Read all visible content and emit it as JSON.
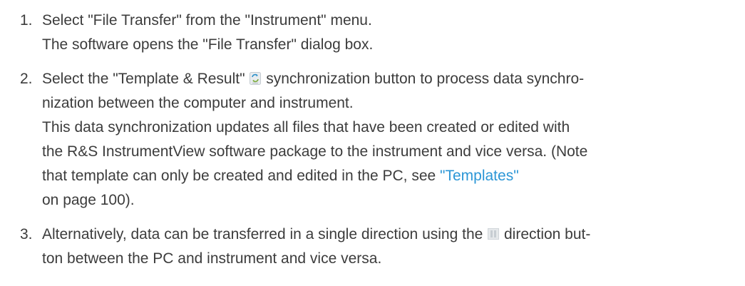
{
  "steps": [
    {
      "number": "1.",
      "lines": [
        "Select \"File Transfer\" from the \"Instrument\" menu.",
        "The software opens the \"File Transfer\" dialog box."
      ]
    },
    {
      "number": "2.",
      "line1_before_icon": "Select the \"Template & Result\" ",
      "sync_icon": "sync-icon",
      "line1_after_icon": " synchronization button to process data synchro-",
      "line2": "nization between the computer and instrument.",
      "line3": "This data synchronization updates all files that have been created or edited with",
      "line4": "the R&S InstrumentView software package to the instrument and vice versa. (Note",
      "line5_before_link": "that template can only be created and edited in the PC, see ",
      "link_text": "\"Templates\"",
      "line6": "on page 100)."
    },
    {
      "number": "3.",
      "line1_before_icon": "Alternatively, data can be transferred in a single direction using the ",
      "direction_icon": "direction-icon",
      "line1_after_icon": " direction but-",
      "line2": "ton between the PC and instrument and vice versa."
    }
  ],
  "colors": {
    "text": "#3c3c3c",
    "link": "#2b96d6"
  }
}
